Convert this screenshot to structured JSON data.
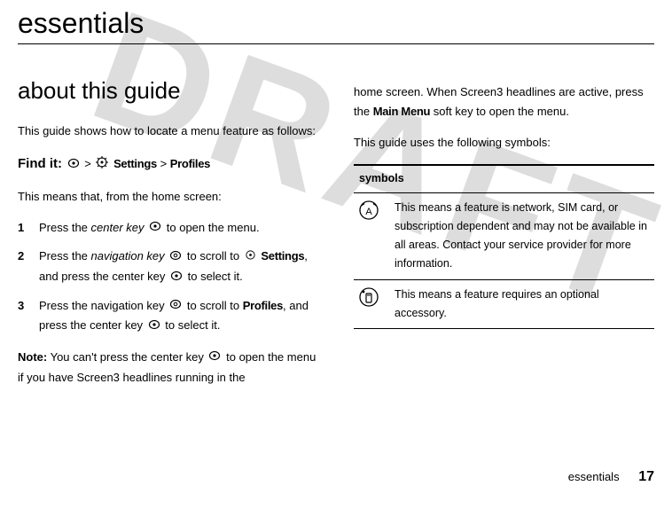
{
  "chapter_title": "essentials",
  "watermark": "DRAFT",
  "left": {
    "section_title": "about this guide",
    "intro": "This guide shows how to locate a menu feature as follows:",
    "findit_label": "Find it:",
    "findit_settings": "Settings",
    "findit_profiles": "Profiles",
    "lead": "This means that, from the home screen:",
    "steps": [
      {
        "n": "1",
        "pre": "Press the ",
        "key": "center key",
        "post": " to open the menu."
      },
      {
        "n": "2",
        "pre": "Press the ",
        "key": "navigation key",
        "mid": " to scroll to ",
        "target": "Settings",
        "post2": ", and press the center key ",
        "tail": " to select it."
      },
      {
        "n": "3",
        "pre": "Press the navigation key ",
        "mid": " to scroll to ",
        "target": "Profiles",
        "post2": ", and press the center key ",
        "tail": " to select it."
      }
    ],
    "note_label": "Note:",
    "note_body": " You can't press the center key ",
    "note_tail": " to open the menu if you have Screen3 headlines running in the"
  },
  "right": {
    "cont1a": "home screen. When Screen3 headlines are active, press the ",
    "cont1b": "Main Menu",
    "cont1c": " soft key to open the menu.",
    "symbols_lead": "This guide uses the following symbols:",
    "table_header": "symbols",
    "row1": "This means a feature is network, SIM card, or subscription dependent and may not be available in all areas. Contact your service provider for more information.",
    "row2": "This means a feature requires an optional accessory."
  },
  "footer": {
    "label": "essentials",
    "page": "17"
  }
}
